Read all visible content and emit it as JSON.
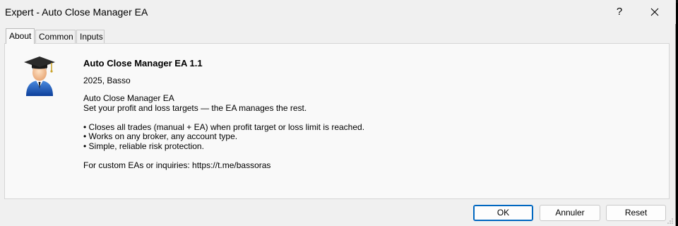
{
  "window": {
    "title": "Expert - Auto Close Manager EA",
    "help_glyph": "?"
  },
  "tabs": [
    {
      "label": "About",
      "active": true
    },
    {
      "label": "Common",
      "active": false
    },
    {
      "label": "Inputs",
      "active": false
    }
  ],
  "about": {
    "icon": "graduate-avatar-icon",
    "title": "Auto Close Manager EA 1.1",
    "copyright": "2025, Basso",
    "description_lines": [
      "Auto Close Manager EA",
      "Set your profit and loss targets — the EA manages the rest.",
      "",
      "• Closes all trades (manual + EA) when profit target or loss limit is reached.",
      "• Works on any broker, any account type.",
      "• Simple, reliable risk protection.",
      "",
      "For custom EAs or inquiries: https://t.me/bassoras"
    ]
  },
  "buttons": {
    "ok": "OK",
    "cancel": "Annuler",
    "reset": "Reset"
  },
  "colors": {
    "dialog_bg": "#f0f0f0",
    "panel_bg": "#f9f9f9",
    "default_button_border": "#0067c0"
  }
}
